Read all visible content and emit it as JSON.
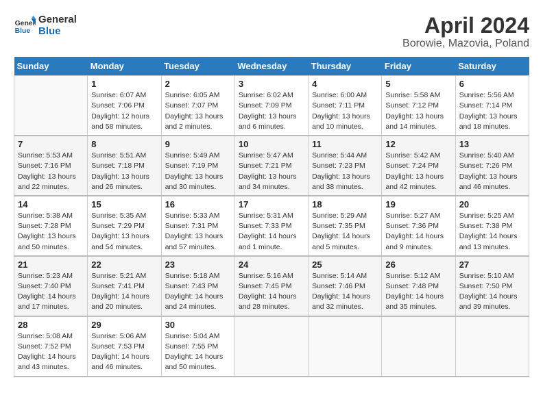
{
  "header": {
    "logo_line1": "General",
    "logo_line2": "Blue",
    "title": "April 2024",
    "subtitle": "Borowie, Mazovia, Poland"
  },
  "days_of_week": [
    "Sunday",
    "Monday",
    "Tuesday",
    "Wednesday",
    "Thursday",
    "Friday",
    "Saturday"
  ],
  "weeks": [
    [
      {
        "day": "",
        "empty": true
      },
      {
        "day": "1",
        "sunrise": "6:07 AM",
        "sunset": "7:06 PM",
        "daylight": "12 hours and 58 minutes."
      },
      {
        "day": "2",
        "sunrise": "6:05 AM",
        "sunset": "7:07 PM",
        "daylight": "13 hours and 2 minutes."
      },
      {
        "day": "3",
        "sunrise": "6:02 AM",
        "sunset": "7:09 PM",
        "daylight": "13 hours and 6 minutes."
      },
      {
        "day": "4",
        "sunrise": "6:00 AM",
        "sunset": "7:11 PM",
        "daylight": "13 hours and 10 minutes."
      },
      {
        "day": "5",
        "sunrise": "5:58 AM",
        "sunset": "7:12 PM",
        "daylight": "13 hours and 14 minutes."
      },
      {
        "day": "6",
        "sunrise": "5:56 AM",
        "sunset": "7:14 PM",
        "daylight": "13 hours and 18 minutes."
      }
    ],
    [
      {
        "day": "7",
        "sunrise": "5:53 AM",
        "sunset": "7:16 PM",
        "daylight": "13 hours and 22 minutes."
      },
      {
        "day": "8",
        "sunrise": "5:51 AM",
        "sunset": "7:18 PM",
        "daylight": "13 hours and 26 minutes."
      },
      {
        "day": "9",
        "sunrise": "5:49 AM",
        "sunset": "7:19 PM",
        "daylight": "13 hours and 30 minutes."
      },
      {
        "day": "10",
        "sunrise": "5:47 AM",
        "sunset": "7:21 PM",
        "daylight": "13 hours and 34 minutes."
      },
      {
        "day": "11",
        "sunrise": "5:44 AM",
        "sunset": "7:23 PM",
        "daylight": "13 hours and 38 minutes."
      },
      {
        "day": "12",
        "sunrise": "5:42 AM",
        "sunset": "7:24 PM",
        "daylight": "13 hours and 42 minutes."
      },
      {
        "day": "13",
        "sunrise": "5:40 AM",
        "sunset": "7:26 PM",
        "daylight": "13 hours and 46 minutes."
      }
    ],
    [
      {
        "day": "14",
        "sunrise": "5:38 AM",
        "sunset": "7:28 PM",
        "daylight": "13 hours and 50 minutes."
      },
      {
        "day": "15",
        "sunrise": "5:35 AM",
        "sunset": "7:29 PM",
        "daylight": "13 hours and 54 minutes."
      },
      {
        "day": "16",
        "sunrise": "5:33 AM",
        "sunset": "7:31 PM",
        "daylight": "13 hours and 57 minutes."
      },
      {
        "day": "17",
        "sunrise": "5:31 AM",
        "sunset": "7:33 PM",
        "daylight": "14 hours and 1 minute."
      },
      {
        "day": "18",
        "sunrise": "5:29 AM",
        "sunset": "7:35 PM",
        "daylight": "14 hours and 5 minutes."
      },
      {
        "day": "19",
        "sunrise": "5:27 AM",
        "sunset": "7:36 PM",
        "daylight": "14 hours and 9 minutes."
      },
      {
        "day": "20",
        "sunrise": "5:25 AM",
        "sunset": "7:38 PM",
        "daylight": "14 hours and 13 minutes."
      }
    ],
    [
      {
        "day": "21",
        "sunrise": "5:23 AM",
        "sunset": "7:40 PM",
        "daylight": "14 hours and 17 minutes."
      },
      {
        "day": "22",
        "sunrise": "5:21 AM",
        "sunset": "7:41 PM",
        "daylight": "14 hours and 20 minutes."
      },
      {
        "day": "23",
        "sunrise": "5:18 AM",
        "sunset": "7:43 PM",
        "daylight": "14 hours and 24 minutes."
      },
      {
        "day": "24",
        "sunrise": "5:16 AM",
        "sunset": "7:45 PM",
        "daylight": "14 hours and 28 minutes."
      },
      {
        "day": "25",
        "sunrise": "5:14 AM",
        "sunset": "7:46 PM",
        "daylight": "14 hours and 32 minutes."
      },
      {
        "day": "26",
        "sunrise": "5:12 AM",
        "sunset": "7:48 PM",
        "daylight": "14 hours and 35 minutes."
      },
      {
        "day": "27",
        "sunrise": "5:10 AM",
        "sunset": "7:50 PM",
        "daylight": "14 hours and 39 minutes."
      }
    ],
    [
      {
        "day": "28",
        "sunrise": "5:08 AM",
        "sunset": "7:52 PM",
        "daylight": "14 hours and 43 minutes."
      },
      {
        "day": "29",
        "sunrise": "5:06 AM",
        "sunset": "7:53 PM",
        "daylight": "14 hours and 46 minutes."
      },
      {
        "day": "30",
        "sunrise": "5:04 AM",
        "sunset": "7:55 PM",
        "daylight": "14 hours and 50 minutes."
      },
      {
        "day": "",
        "empty": true
      },
      {
        "day": "",
        "empty": true
      },
      {
        "day": "",
        "empty": true
      },
      {
        "day": "",
        "empty": true
      }
    ]
  ]
}
